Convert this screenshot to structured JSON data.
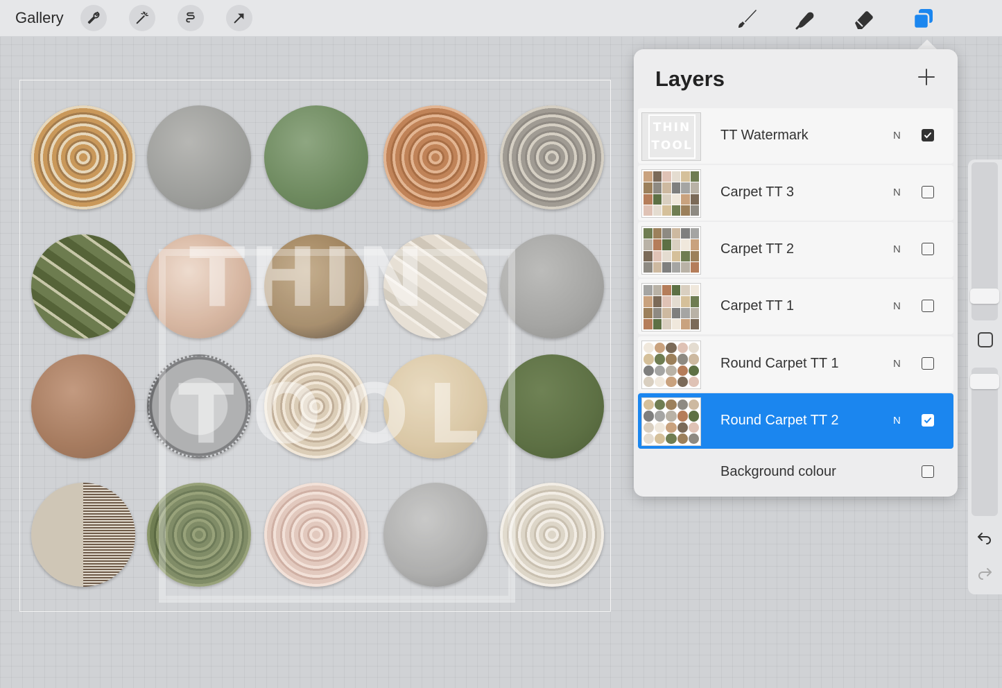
{
  "toolbar": {
    "gallery_label": "Gallery",
    "left_tools": [
      "wrench-icon",
      "magic-wand-icon",
      "selection-icon",
      "transform-arrow-icon"
    ],
    "right_tools": [
      "brush-icon",
      "smudge-icon",
      "eraser-icon",
      "layers-icon"
    ],
    "accent": "#1b86ef"
  },
  "canvas": {
    "watermark_line1": "THIN",
    "watermark_line2": "TOOL",
    "rugs": [
      {
        "colors": [
          "#c9985a",
          "#e6d7bb",
          "#a47c4d"
        ],
        "style": "rings"
      },
      {
        "colors": [
          "#9d9e9b",
          "#b7b7b4",
          "#8a8b88"
        ],
        "style": "solid"
      },
      {
        "colors": [
          "#6e8a5f",
          "#8ea681",
          "#5d7550"
        ],
        "style": "solid"
      },
      {
        "colors": [
          "#c08358",
          "#e2b592",
          "#a86e45"
        ],
        "style": "rings"
      },
      {
        "colors": [
          "#a09b93",
          "#d5cfc3",
          "#8f8a83"
        ],
        "style": "rings"
      },
      {
        "colors": [
          "#6d7c4f",
          "#c7c7a8",
          "#556338"
        ],
        "style": "streak"
      },
      {
        "colors": [
          "#d1ac94",
          "#ecd7c8",
          "#b08f79"
        ],
        "style": "solid"
      },
      {
        "colors": [
          "#9c805b",
          "#bda37e",
          "#3b3026"
        ],
        "style": "solid"
      },
      {
        "colors": [
          "#e4dcd0",
          "#f3ede4",
          "#cfc6b8"
        ],
        "style": "streak"
      },
      {
        "colors": [
          "#a5a5a3",
          "#bcbcba",
          "#8f8f8d"
        ],
        "style": "solid"
      },
      {
        "colors": [
          "#a67b5f",
          "#c39a80",
          "#8f6a52"
        ],
        "style": "solid"
      },
      {
        "colors": [
          "#a6a7a8",
          "#c8c9ca",
          "#6d6e70"
        ],
        "style": "fringe"
      },
      {
        "colors": [
          "#d7c6ad",
          "#efe4d3",
          "#b8a38a"
        ],
        "style": "rings"
      },
      {
        "colors": [
          "#d5c09a",
          "#e6d6b8",
          "#c0a97f"
        ],
        "style": "solid"
      },
      {
        "colors": [
          "#5d7044",
          "#6f8255",
          "#4c5d36"
        ],
        "style": "solid"
      },
      {
        "colors": [
          "#cfc6b6",
          "#6e5a48",
          "#e2dbcf"
        ],
        "style": "split"
      },
      {
        "colors": [
          "#6f7d52",
          "#8a9668",
          "#5b6942"
        ],
        "style": "rings"
      },
      {
        "colors": [
          "#dfc2b5",
          "#f1ddd3",
          "#c9a698"
        ],
        "style": "rings"
      },
      {
        "colors": [
          "#a3a3a2",
          "#c2c2c1",
          "#7f7f7e"
        ],
        "style": "solid"
      },
      {
        "colors": [
          "#ddd6c8",
          "#f2ede5",
          "#c9c0b0"
        ],
        "style": "rings"
      }
    ]
  },
  "layers_panel": {
    "title": "Layers",
    "add_icon": "plus-icon",
    "layers": [
      {
        "name": "TT Watermark",
        "mode": "N",
        "visible": true,
        "selected": false,
        "thumb_text": "THIN TOOL"
      },
      {
        "name": "Carpet TT 3",
        "mode": "N",
        "visible": false,
        "selected": false
      },
      {
        "name": "Carpet TT 2",
        "mode": "N",
        "visible": false,
        "selected": false
      },
      {
        "name": "Carpet TT 1",
        "mode": "N",
        "visible": false,
        "selected": false
      },
      {
        "name": "Round Carpet TT 1",
        "mode": "N",
        "visible": false,
        "selected": false
      },
      {
        "name": "Round Carpet TT 2",
        "mode": "N",
        "visible": true,
        "selected": true
      }
    ],
    "background": {
      "name": "Background colour",
      "visible": false
    }
  },
  "sidebar": {
    "undo_icon": "undo-icon",
    "redo_icon": "redo-icon",
    "modify_icon": "square-modify-icon"
  }
}
